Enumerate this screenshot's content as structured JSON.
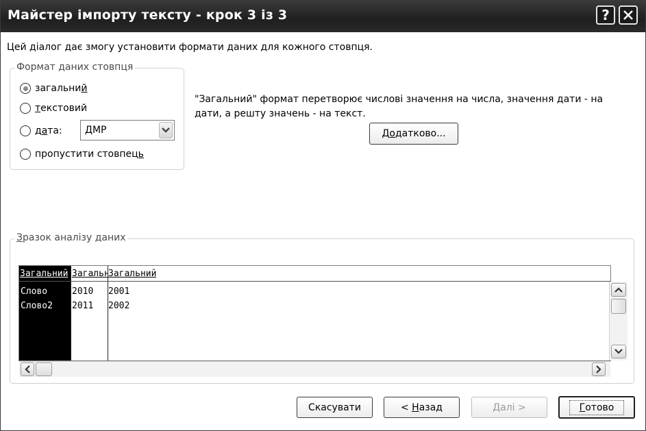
{
  "window": {
    "title": "Майстер імпорту тексту - крок 3 із 3",
    "help_label": "?"
  },
  "description": "Цей діалог дає змогу установити формати даних для кожного стовпця.",
  "column_format": {
    "title": "Формат даних стовпця",
    "options": [
      {
        "label_pre": "загальни",
        "label_ul": "й",
        "label_post": "",
        "selected": true
      },
      {
        "label_pre": "",
        "label_ul": "т",
        "label_post": "екстовий",
        "selected": false
      },
      {
        "label_pre": "д",
        "label_ul": "а",
        "label_post": "та:",
        "selected": false
      },
      {
        "label_pre": "пропустити стовпец",
        "label_ul": "ь",
        "label_post": "",
        "selected": false
      }
    ],
    "date_format": "ДМР"
  },
  "info_text": "\"Загальний\" формат перетворює числові значення на числа, значення дати - на дати, а решту значень - на текст.",
  "advanced_button": {
    "pre": "Д",
    "ul": "о",
    "post": "датково..."
  },
  "preview": {
    "title_ul": "З",
    "title_rest": "разок аналізу даних",
    "headers": [
      "Загальний",
      "Загальний",
      "Загальний"
    ],
    "rows": [
      [
        "Слово",
        "2010",
        "2001"
      ],
      [
        "Слово2",
        "2011",
        "2002"
      ]
    ]
  },
  "buttons": {
    "cancel": "Скасувати",
    "back_pre": "< ",
    "back_ul": "Н",
    "back_post": "азад",
    "next": "Далі >",
    "finish_ul": "Г",
    "finish_post": "отово"
  }
}
